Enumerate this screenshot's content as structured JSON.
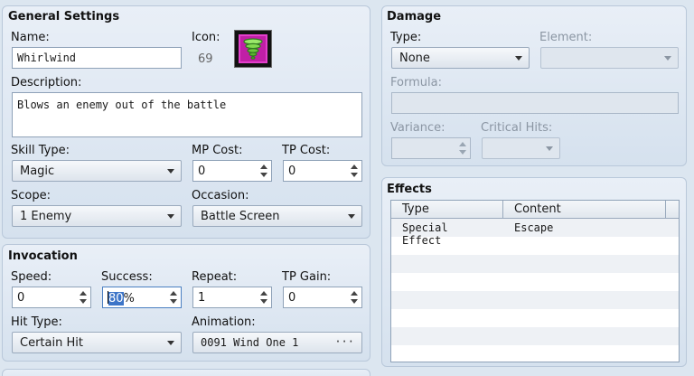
{
  "general": {
    "title": "General Settings",
    "name_label": "Name:",
    "name_value": "Whirlwind",
    "icon_label": "Icon:",
    "icon_index": "69",
    "description_label": "Description:",
    "description_value": "Blows an enemy out of the battle",
    "skill_type_label": "Skill Type:",
    "skill_type_value": "Magic",
    "mp_cost_label": "MP Cost:",
    "mp_cost_value": "0",
    "tp_cost_label": "TP Cost:",
    "tp_cost_value": "0",
    "scope_label": "Scope:",
    "scope_value": "1 Enemy",
    "occasion_label": "Occasion:",
    "occasion_value": "Battle Screen"
  },
  "invocation": {
    "title": "Invocation",
    "speed_label": "Speed:",
    "speed_value": "0",
    "success_label": "Success:",
    "success_value": "80",
    "success_unit": "%",
    "repeat_label": "Repeat:",
    "repeat_value": "1",
    "tp_gain_label": "TP Gain:",
    "tp_gain_value": "0",
    "hit_type_label": "Hit Type:",
    "hit_type_value": "Certain Hit",
    "animation_label": "Animation:",
    "animation_value": "0091 Wind One 1",
    "animation_button": "···"
  },
  "damage": {
    "title": "Damage",
    "type_label": "Type:",
    "type_value": "None",
    "element_label": "Element:",
    "element_value": "",
    "formula_label": "Formula:",
    "formula_value": "",
    "variance_label": "Variance:",
    "variance_value": "",
    "critical_label": "Critical Hits:",
    "critical_value": ""
  },
  "effects": {
    "title": "Effects",
    "columns": [
      "Type",
      "Content"
    ],
    "rows": [
      [
        "Special Effect",
        "Escape"
      ],
      [
        "",
        ""
      ],
      [
        "",
        ""
      ],
      [
        "",
        ""
      ],
      [
        "",
        ""
      ],
      [
        "",
        ""
      ],
      [
        "",
        ""
      ]
    ]
  },
  "icon": {
    "semantic": "whirlwind-icon",
    "frame_color": "#c01fa6",
    "tornado_color": "#7ed957"
  }
}
